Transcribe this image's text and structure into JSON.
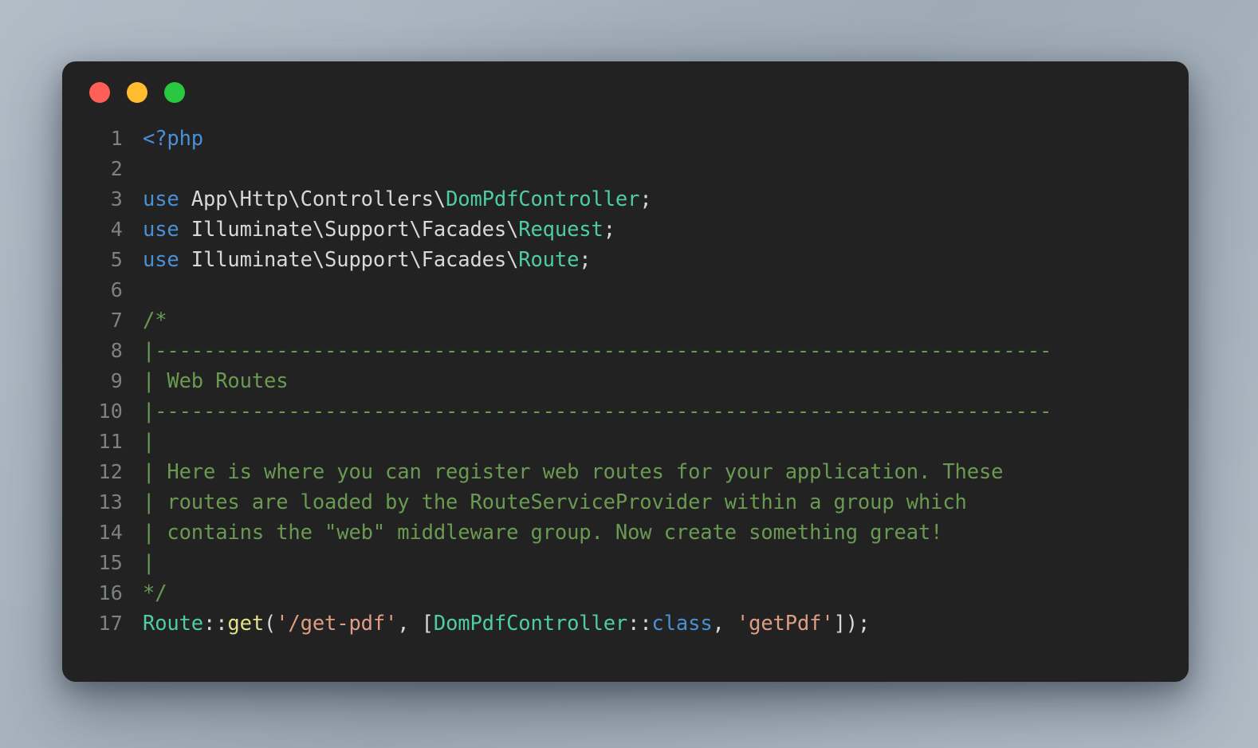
{
  "window": {
    "name": "code-editor-window",
    "traffic_lights": [
      {
        "name": "close-button",
        "color": "#FF5F57"
      },
      {
        "name": "minimize-button",
        "color": "#FEBC2E"
      },
      {
        "name": "maximize-button",
        "color": "#28C840"
      }
    ],
    "background_color": "#222222"
  },
  "theme": {
    "line_number_color": "#7d8184",
    "plain_color": "#d8d8d8",
    "keyword_color": "#4b8fd6",
    "type_color": "#4ecca3",
    "comment_color": "#6a9a52",
    "function_color": "#e3e08a",
    "string_color": "#df9d83"
  },
  "code": {
    "language": "php",
    "lines": [
      {
        "number": "1",
        "text": "<?php",
        "tokens": [
          {
            "t": "<?php",
            "c": "tok-tag"
          }
        ]
      },
      {
        "number": "2",
        "text": "",
        "tokens": []
      },
      {
        "number": "3",
        "text": "use App\\Http\\Controllers\\DomPdfController;",
        "tokens": [
          {
            "t": "use",
            "c": "tok-keyword"
          },
          {
            "t": " App\\Http\\Controllers\\",
            "c": "tok-plain"
          },
          {
            "t": "DomPdfController",
            "c": "tok-type"
          },
          {
            "t": ";",
            "c": "tok-punct"
          }
        ]
      },
      {
        "number": "4",
        "text": "use Illuminate\\Support\\Facades\\Request;",
        "tokens": [
          {
            "t": "use",
            "c": "tok-keyword"
          },
          {
            "t": " Illuminate\\Support\\Facades\\",
            "c": "tok-plain"
          },
          {
            "t": "Request",
            "c": "tok-type"
          },
          {
            "t": ";",
            "c": "tok-punct"
          }
        ]
      },
      {
        "number": "5",
        "text": "use Illuminate\\Support\\Facades\\Route;",
        "tokens": [
          {
            "t": "use",
            "c": "tok-keyword"
          },
          {
            "t": " Illuminate\\Support\\Facades\\",
            "c": "tok-plain"
          },
          {
            "t": "Route",
            "c": "tok-type"
          },
          {
            "t": ";",
            "c": "tok-punct"
          }
        ]
      },
      {
        "number": "6",
        "text": "",
        "tokens": []
      },
      {
        "number": "7",
        "text": "/*",
        "tokens": [
          {
            "t": "/*",
            "c": "tok-comment"
          }
        ]
      },
      {
        "number": "8",
        "text": "|--------------------------------------------------------------------------",
        "tokens": [
          {
            "t": "|--------------------------------------------------------------------------",
            "c": "tok-comment"
          }
        ]
      },
      {
        "number": "9",
        "text": "| Web Routes",
        "tokens": [
          {
            "t": "| Web Routes",
            "c": "tok-comment"
          }
        ]
      },
      {
        "number": "10",
        "text": "|--------------------------------------------------------------------------",
        "tokens": [
          {
            "t": "|--------------------------------------------------------------------------",
            "c": "tok-comment"
          }
        ]
      },
      {
        "number": "11",
        "text": "|",
        "tokens": [
          {
            "t": "|",
            "c": "tok-comment"
          }
        ]
      },
      {
        "number": "12",
        "text": "| Here is where you can register web routes for your application. These",
        "tokens": [
          {
            "t": "| Here is where you can register web routes for your application. These",
            "c": "tok-comment"
          }
        ]
      },
      {
        "number": "13",
        "text": "| routes are loaded by the RouteServiceProvider within a group which",
        "tokens": [
          {
            "t": "| routes are loaded by the RouteServiceProvider within a group which",
            "c": "tok-comment"
          }
        ]
      },
      {
        "number": "14",
        "text": "| contains the \"web\" middleware group. Now create something great!",
        "tokens": [
          {
            "t": "| contains the \"web\" middleware group. Now create something great!",
            "c": "tok-comment"
          }
        ]
      },
      {
        "number": "15",
        "text": "|",
        "tokens": [
          {
            "t": "|",
            "c": "tok-comment"
          }
        ]
      },
      {
        "number": "16",
        "text": "*/",
        "tokens": [
          {
            "t": "*/",
            "c": "tok-comment"
          }
        ]
      },
      {
        "number": "17",
        "text": "Route::get('/get-pdf', [DomPdfController::class, 'getPdf']);",
        "tokens": [
          {
            "t": "Route",
            "c": "tok-type"
          },
          {
            "t": "::",
            "c": "tok-punct"
          },
          {
            "t": "get",
            "c": "tok-func"
          },
          {
            "t": "(",
            "c": "tok-punct"
          },
          {
            "t": "'/get-pdf'",
            "c": "tok-string"
          },
          {
            "t": ", [",
            "c": "tok-punct"
          },
          {
            "t": "DomPdfController",
            "c": "tok-type"
          },
          {
            "t": "::",
            "c": "tok-punct"
          },
          {
            "t": "class",
            "c": "tok-keyword"
          },
          {
            "t": ", ",
            "c": "tok-punct"
          },
          {
            "t": "'getPdf'",
            "c": "tok-string"
          },
          {
            "t": "]);",
            "c": "tok-punct"
          }
        ]
      }
    ]
  }
}
